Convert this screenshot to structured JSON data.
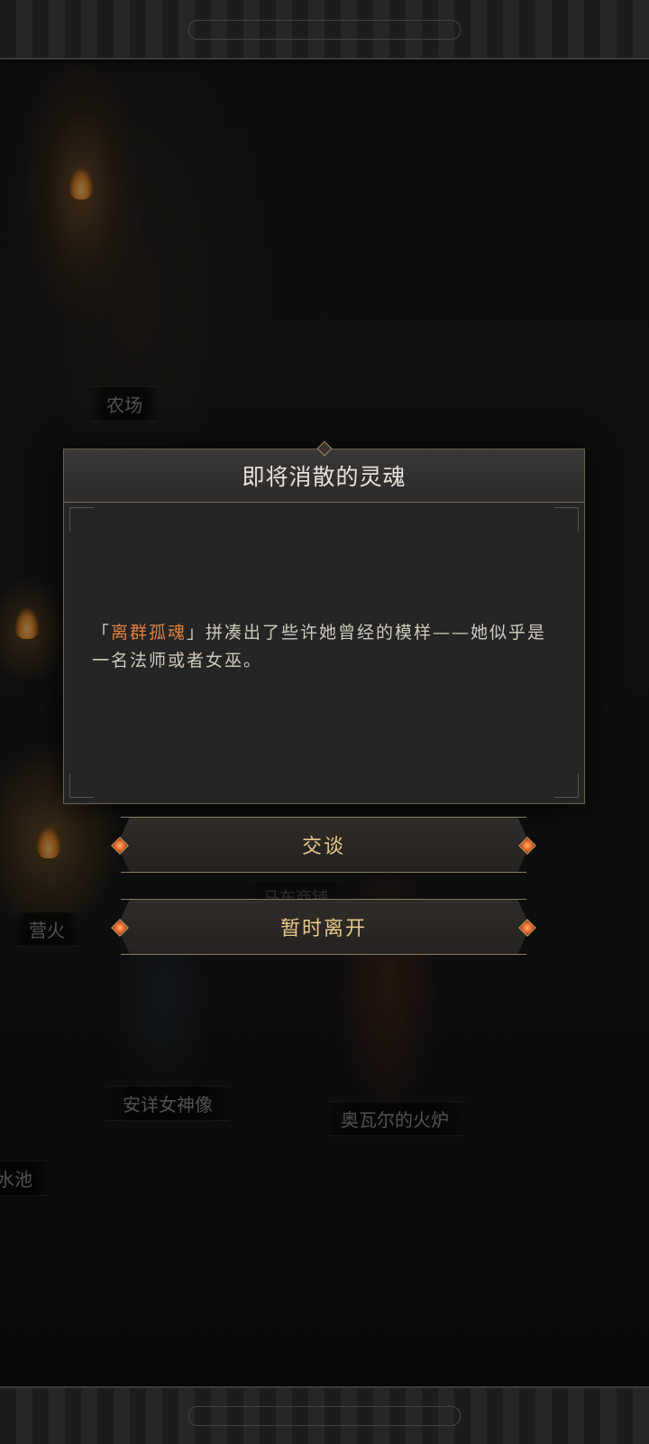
{
  "dialog": {
    "title": "即将消散的灵魂",
    "body_open": "「",
    "body_highlight": "离群孤魂",
    "body_rest": "」拼凑出了些许她曾经的模样——她似乎是一名法师或者女巫。",
    "colors": {
      "highlight": "#e0813e",
      "text": "#cfc8bc"
    }
  },
  "choices": [
    {
      "label": "交谈"
    },
    {
      "label": "暂时离开"
    }
  ],
  "map_labels": {
    "farm": "农场",
    "campfire": "营火",
    "goddess_statue": "安详女神像",
    "forge": "奥瓦尔的火炉",
    "pool_partial": "水池",
    "shop_partial": "马车商铺"
  }
}
